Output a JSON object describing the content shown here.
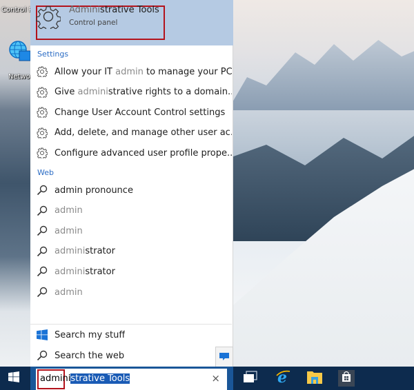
{
  "desktop": {
    "top_label": "Control P",
    "icon_label": "Network"
  },
  "best_match": {
    "title_match": "Admini",
    "title_rest": "strative Tools",
    "subtitle": "Control panel",
    "icon": "gear-icon"
  },
  "settings": {
    "heading": "Settings",
    "items": [
      {
        "parts": [
          {
            "t": "Allow your IT ",
            "m": false
          },
          {
            "t": "admin",
            "m": true
          },
          {
            "t": " to manage your PC",
            "m": false
          }
        ]
      },
      {
        "parts": [
          {
            "t": "Give ",
            "m": false
          },
          {
            "t": "admini",
            "m": true
          },
          {
            "t": "strative rights to a domain...",
            "m": false
          }
        ]
      },
      {
        "parts": [
          {
            "t": "Change User Account Control settings",
            "m": false
          }
        ]
      },
      {
        "parts": [
          {
            "t": "Add, delete, and manage other user ac...",
            "m": false
          }
        ]
      },
      {
        "parts": [
          {
            "t": "Configure advanced user profile prope...",
            "m": false
          }
        ]
      }
    ]
  },
  "web": {
    "heading": "Web",
    "items": [
      {
        "parts": [
          {
            "t": "admin    pronounce",
            "m": false
          }
        ]
      },
      {
        "parts": [
          {
            "t": "admin",
            "m": true
          }
        ]
      },
      {
        "parts": [
          {
            "t": "admin",
            "m": true
          }
        ]
      },
      {
        "parts": [
          {
            "t": "admini",
            "m": true
          },
          {
            "t": "strator",
            "m": false
          }
        ]
      },
      {
        "parts": [
          {
            "t": "admini",
            "m": true
          },
          {
            "t": "strator",
            "m": false
          }
        ]
      },
      {
        "parts": [
          {
            "t": "admin",
            "m": true
          }
        ]
      }
    ]
  },
  "footer": {
    "search_my_stuff": "Search my stuff",
    "search_the_web": "Search the web"
  },
  "taskbar": {
    "search_typed": "admini",
    "search_autocomplete": "strative Tools",
    "clear_symbol": "×",
    "apps": [
      "task-view",
      "internet-explorer",
      "file-explorer",
      "store"
    ]
  },
  "colors": {
    "accent": "#2b6cc4",
    "highlight": "#b5cae3",
    "annotation": "#b3121b",
    "taskbar": "#0d2b4e",
    "search_bar": "#1a5698"
  }
}
